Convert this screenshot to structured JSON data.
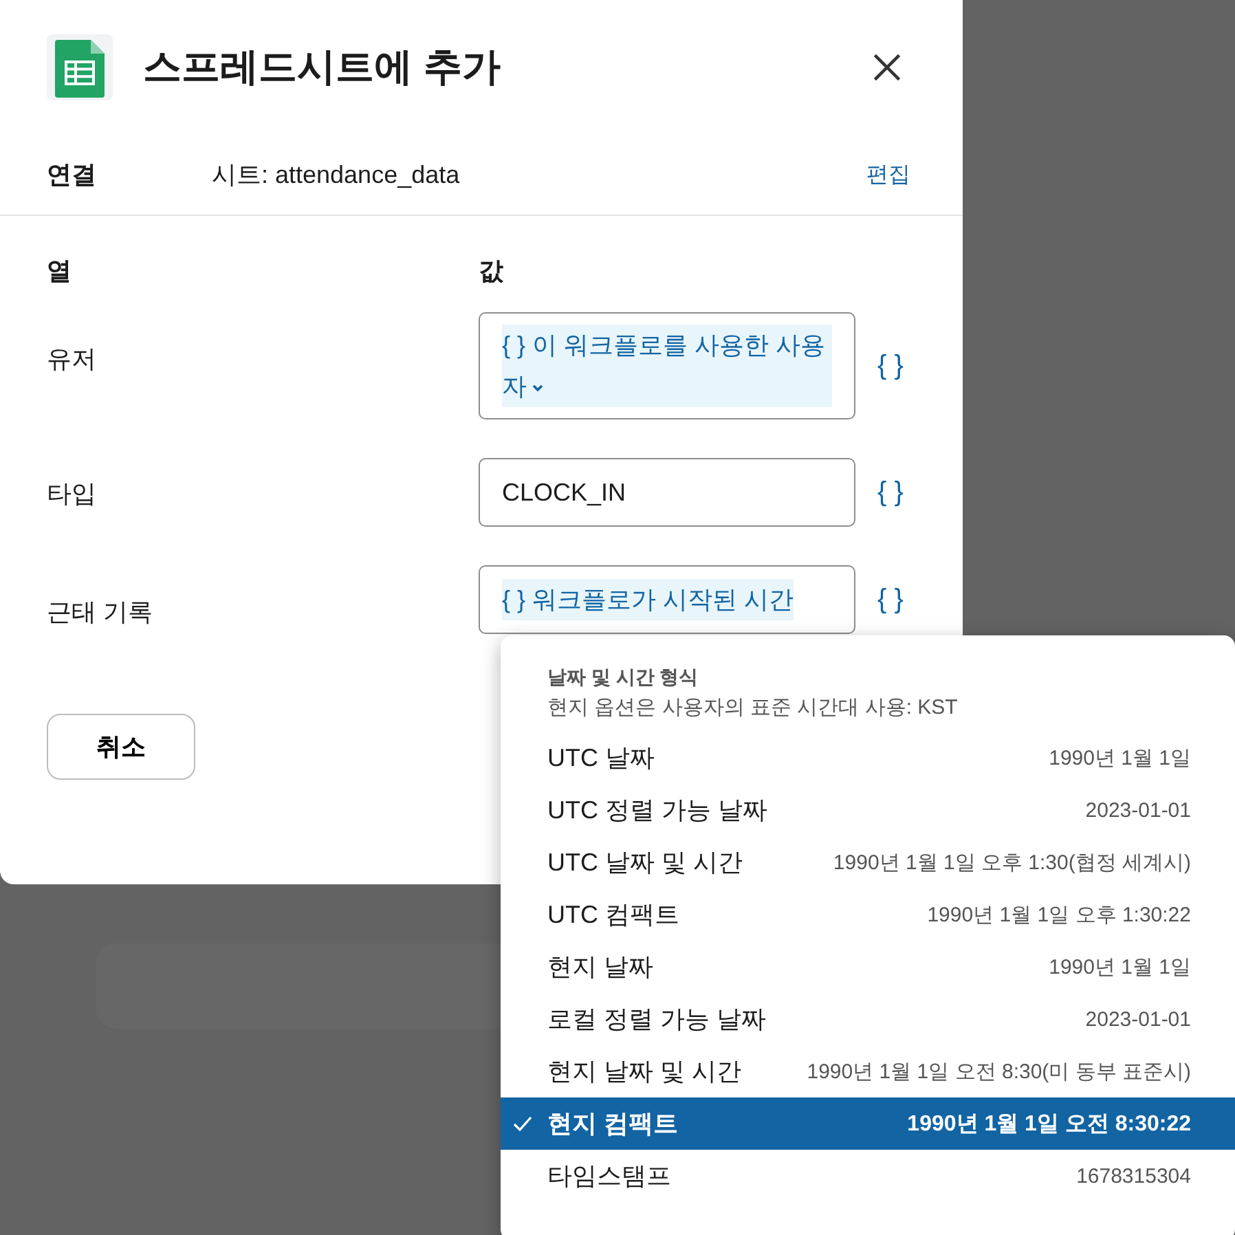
{
  "dialog": {
    "title": "스프레드시트에 추가",
    "connection": {
      "label": "연결",
      "value": "시트: attendance_data",
      "action": "편집"
    },
    "headers": {
      "column": "열",
      "value": "값"
    },
    "rows": [
      {
        "label": "유저",
        "kind": "token",
        "value": "{ } 이 워크플로를 사용한 사용자",
        "chevron": true,
        "insert": "{ }"
      },
      {
        "label": "타입",
        "kind": "text",
        "value": "CLOCK_IN",
        "insert": "{ }"
      },
      {
        "label": "근태 기록",
        "kind": "token",
        "value": "{ } 워크플로가 시작된 시간",
        "chevron": false,
        "insert": "{ }"
      }
    ],
    "cancel": "취소"
  },
  "menu": {
    "title": "날짜 및 시간 형식",
    "subtitle": "현지 옵션은 사용자의 표준 시간대 사용: KST",
    "items": [
      {
        "label": "UTC 날짜",
        "value": "1990년 1월 1일",
        "selected": false
      },
      {
        "label": "UTC 정렬 가능 날짜",
        "value": "2023-01-01",
        "selected": false
      },
      {
        "label": "UTC 날짜 및 시간",
        "value": "1990년 1월 1일 오후 1:30(협정 세계시)",
        "selected": false
      },
      {
        "label": "UTC 컴팩트",
        "value": "1990년 1월 1일 오후 1:30:22",
        "selected": false
      },
      {
        "label": "현지 날짜",
        "value": "1990년 1월 1일",
        "selected": false
      },
      {
        "label": "로컬 정렬 가능 날짜",
        "value": "2023-01-01",
        "selected": false
      },
      {
        "label": "현지 날짜 및 시간",
        "value": "1990년 1월 1일 오전 8:30(미 동부 표준시)",
        "selected": false
      },
      {
        "label": "현지 컴팩트",
        "value": "1990년 1월 1일 오전 8:30:22",
        "selected": true
      },
      {
        "label": "타임스탬프",
        "value": "1678315304",
        "selected": false
      }
    ]
  }
}
